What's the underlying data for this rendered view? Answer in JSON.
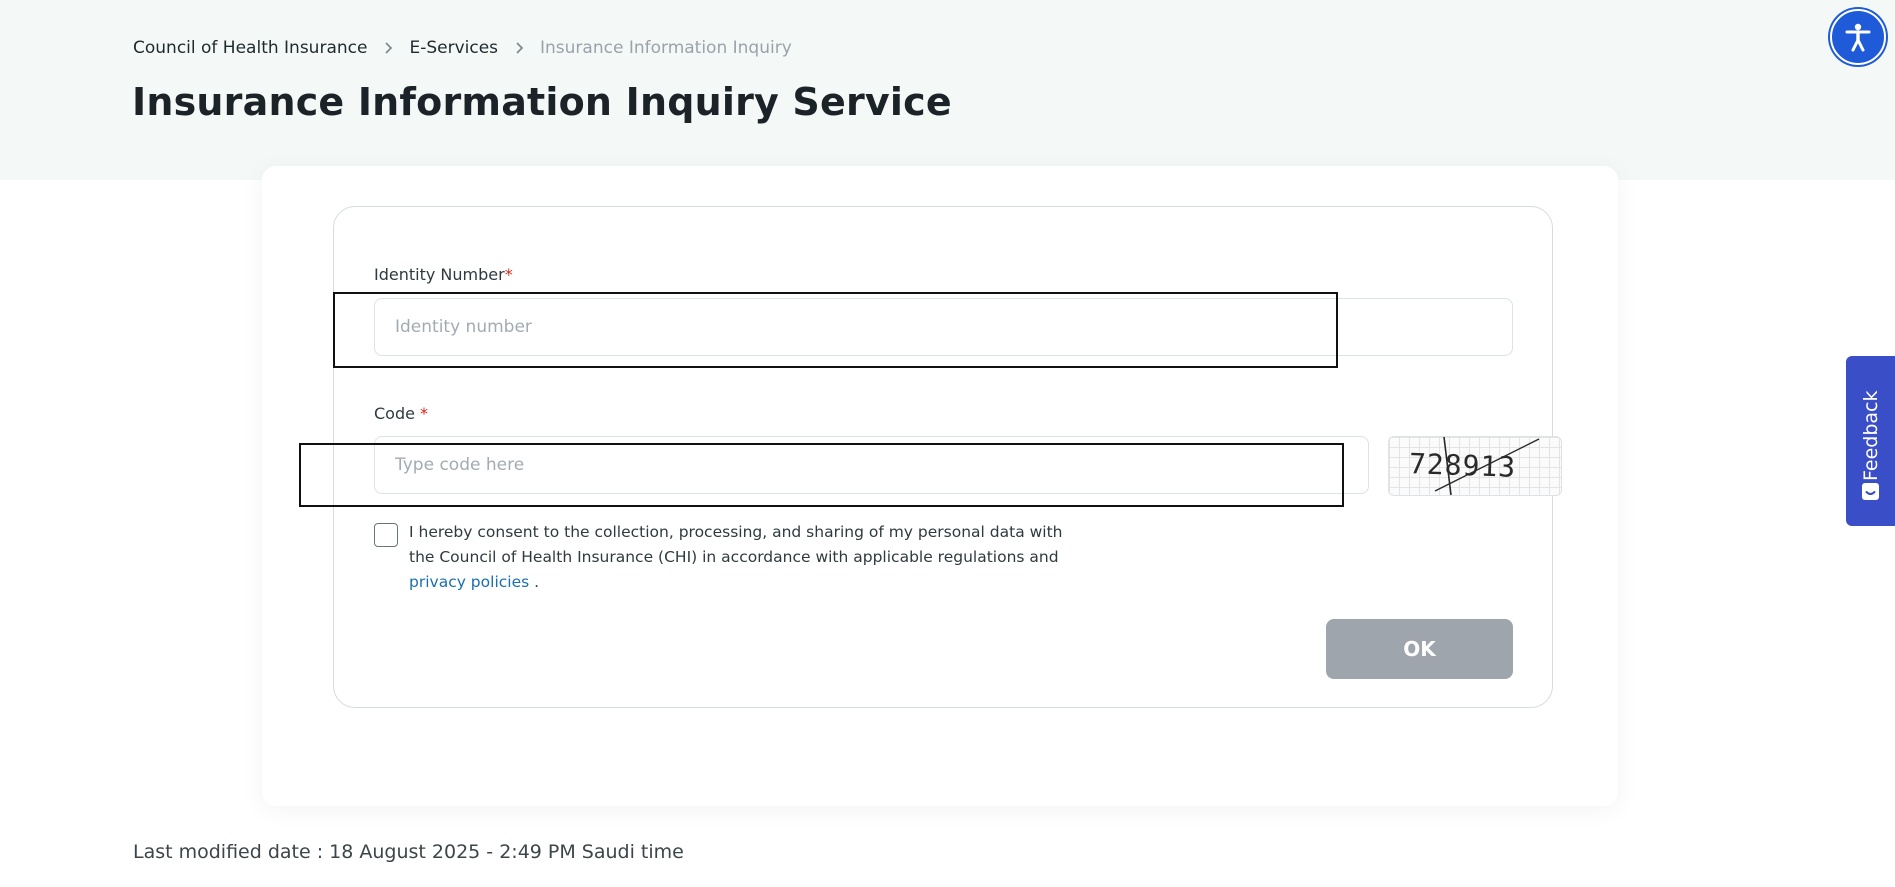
{
  "breadcrumb": {
    "items": [
      "Council of Health Insurance",
      "E-Services",
      "Insurance Information Inquiry"
    ]
  },
  "page": {
    "title": "Insurance Information Inquiry Service"
  },
  "form": {
    "identity": {
      "label": "Identity Number",
      "required_mark": "*",
      "placeholder": "Identity number",
      "value": ""
    },
    "code": {
      "label": "Code ",
      "required_mark": "*",
      "placeholder": "Type code here",
      "value": ""
    },
    "captcha": {
      "text": "728913"
    },
    "consent": {
      "checked": false,
      "text": "I hereby consent to the collection, processing, and sharing of my personal data with the Council of Health Insurance (CHI) in accordance with applicable regulations and ",
      "link_text": "privacy policies",
      "suffix": " ."
    },
    "ok_label": "OK"
  },
  "feedback": {
    "label": "Feedback"
  },
  "footer": {
    "last_modified": "Last modified date : 18 August 2025 - 2:49 PM Saudi time"
  },
  "colors": {
    "top_band": "#f4f8f6",
    "required": "#d2281f",
    "link": "#1a6fb0",
    "ok_button_disabled": "#9ea5ad",
    "feedback_tab": "#3a4fc7",
    "accessibility_button": "#1f5bd8"
  },
  "icons": {
    "breadcrumb_separator": "chevron-right-icon",
    "accessibility": "accessibility-icon",
    "feedback": "feedback-smile-icon"
  }
}
